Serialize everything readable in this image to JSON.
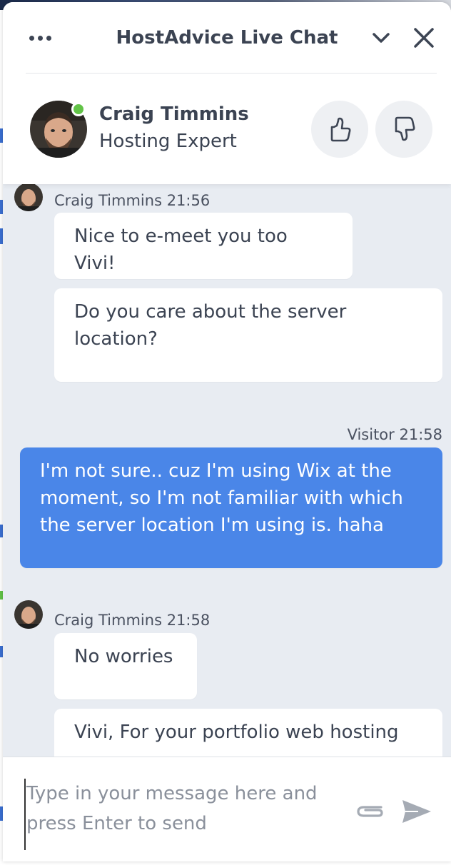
{
  "widget": {
    "title": "HostAdvice Live Chat",
    "menu_icon": "more-dots-icon",
    "minimize_icon": "chevron-down-icon",
    "close_icon": "close-icon"
  },
  "agent": {
    "name": "Craig Timmins",
    "role": "Hosting Expert",
    "status": "online",
    "status_color": "#62c347",
    "rate_up_icon": "thumbs-up-icon",
    "rate_down_icon": "thumbs-down-icon"
  },
  "messages": [
    {
      "sender": "Craig Timmins 21:56",
      "type": "agent",
      "bubbles": [
        "Nice to e-meet you too Vivi!",
        "Do you care about the server location?"
      ]
    },
    {
      "sender": "Visitor 21:58",
      "type": "visitor",
      "bubbles": [
        "I'm not sure.. cuz I'm using Wix at the moment, so I'm not familiar with which the server location I'm using is. haha"
      ]
    },
    {
      "sender": "Craig Timmins 21:58",
      "type": "agent",
      "bubbles": [
        "No worries",
        "Vivi, For your portfolio web hosting"
      ]
    }
  ],
  "composer": {
    "placeholder": "Type in your message here and press Enter to send",
    "attach_icon": "paperclip-icon",
    "send_icon": "send-icon"
  },
  "colors": {
    "visitor_bubble": "#4a86e8",
    "chat_background": "#e8ecf2",
    "text": "#3b4352"
  }
}
